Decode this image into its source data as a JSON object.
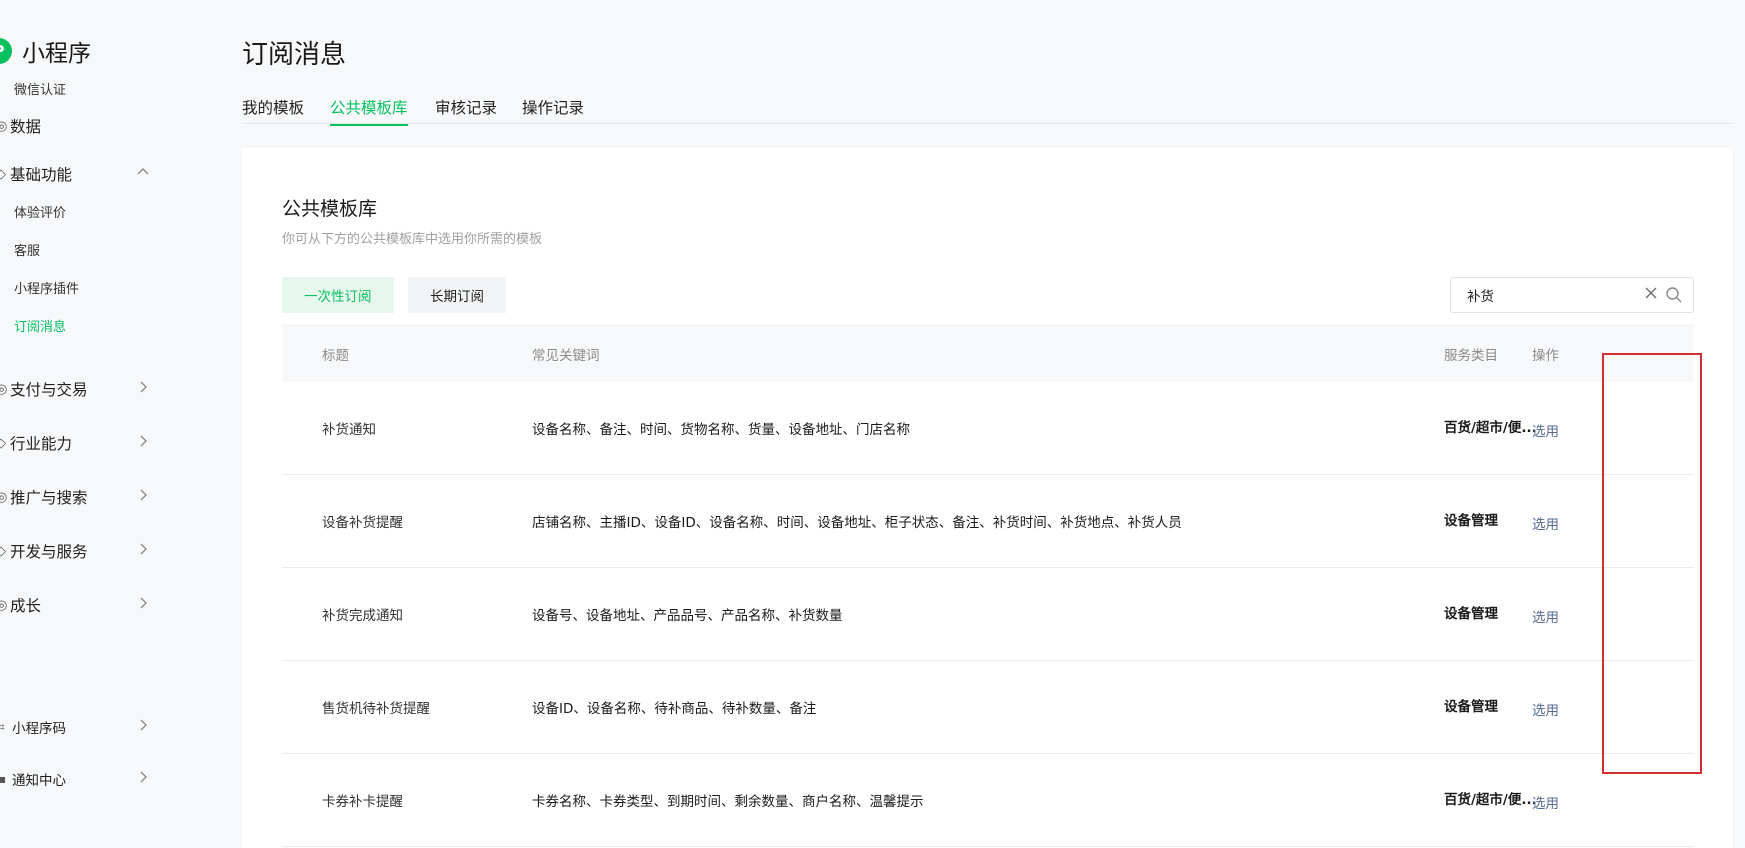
{
  "sidebar": {
    "brand_logo": "P",
    "brand_title": "小程序",
    "wechat_cert": "微信认证",
    "items": [
      {
        "label": "数据"
      },
      {
        "label": "基础功能"
      },
      {
        "label": "支付与交易"
      },
      {
        "label": "行业能力"
      },
      {
        "label": "推广与搜索"
      },
      {
        "label": "开发与服务"
      },
      {
        "label": "成长"
      }
    ],
    "sub_items": [
      {
        "label": "体验评价"
      },
      {
        "label": "客服"
      },
      {
        "label": "小程序插件"
      },
      {
        "label": "订阅消息"
      }
    ],
    "bottom_items": [
      {
        "label": "小程序码"
      },
      {
        "label": "通知中心"
      }
    ]
  },
  "page": {
    "title": "订阅消息",
    "tabs": [
      {
        "label": "我的模板"
      },
      {
        "label": "公共模板库"
      },
      {
        "label": "审核记录"
      },
      {
        "label": "操作记录"
      }
    ]
  },
  "card": {
    "title": "公共模板库",
    "description": "你可从下方的公共模板库中选用你所需的模板",
    "seg_buttons": [
      {
        "label": "一次性订阅"
      },
      {
        "label": "长期订阅"
      }
    ],
    "search": {
      "value": "补货"
    }
  },
  "table": {
    "headers": [
      "标题",
      "常见关键词",
      "服务类目",
      "操作"
    ],
    "rows": [
      {
        "title": "补货通知",
        "keywords": "设备名称、备注、时间、货物名称、货量、设备地址、门店名称",
        "category": "百货/超市/便...",
        "action": "选用"
      },
      {
        "title": "设备补货提醒",
        "keywords": "店铺名称、主播ID、设备ID、设备名称、时间、设备地址、柜子状态、备注、补货时间、补货地点、补货人员",
        "category": "设备管理",
        "action": "选用"
      },
      {
        "title": "补货完成通知",
        "keywords": "设备号、设备地址、产品品号、产品名称、补货数量",
        "category": "设备管理",
        "action": "选用"
      },
      {
        "title": "售货机待补货提醒",
        "keywords": "设备ID、设备名称、待补商品、待补数量、备注",
        "category": "设备管理",
        "action": "选用"
      },
      {
        "title": "卡券补卡提醒",
        "keywords": "卡券名称、卡券类型、到期时间、剩余数量、商户名称、温馨提示",
        "category": "百货/超市/便...",
        "action": "选用"
      }
    ]
  },
  "colors": {
    "accent": "#07c160",
    "link": "#576b95",
    "annotation": "#d32f2f"
  }
}
